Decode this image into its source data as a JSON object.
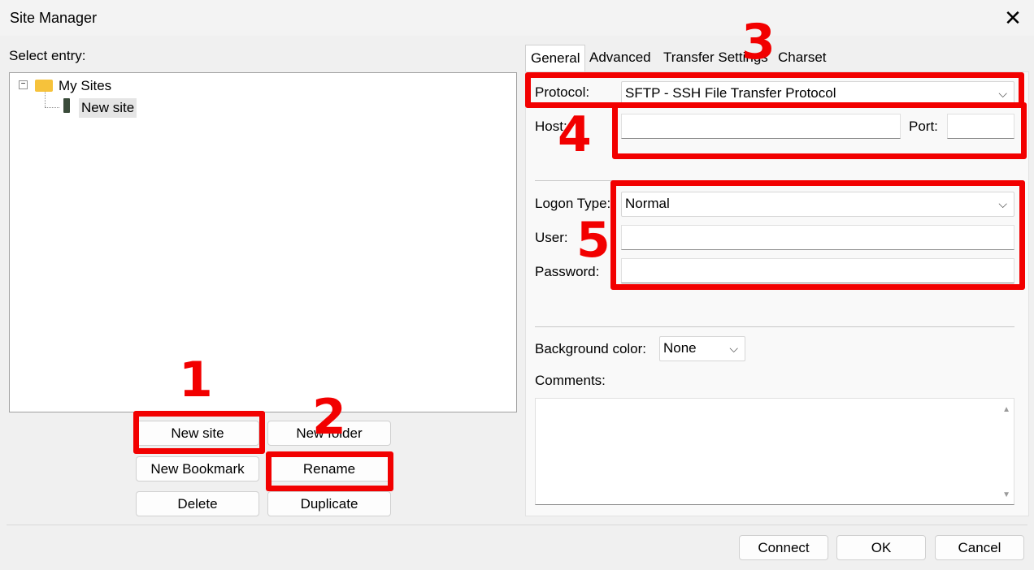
{
  "window": {
    "title": "Site Manager"
  },
  "left": {
    "select_label": "Select entry:",
    "tree": {
      "root": "My Sites",
      "child": "New site"
    },
    "buttons": {
      "new_site": "New site",
      "new_folder": "New folder",
      "new_bookmark": "New Bookmark",
      "rename": "Rename",
      "delete": "Delete",
      "duplicate": "Duplicate"
    }
  },
  "tabs": [
    "General",
    "Advanced",
    "Transfer Settings",
    "Charset"
  ],
  "general": {
    "protocol_label": "Protocol:",
    "protocol_value": "SFTP - SSH File Transfer Protocol",
    "host_label": "Host:",
    "port_label": "Port:",
    "logon_type_label": "Logon Type:",
    "logon_type_value": "Normal",
    "user_label": "User:",
    "password_label": "Password:",
    "bg_color_label": "Background color:",
    "bg_color_value": "None",
    "comments_label": "Comments:"
  },
  "footer": {
    "connect": "Connect",
    "ok": "OK",
    "cancel": "Cancel"
  },
  "annotations": [
    "1",
    "2",
    "3",
    "4",
    "5"
  ],
  "colors": {
    "annotation": "#f20000"
  }
}
